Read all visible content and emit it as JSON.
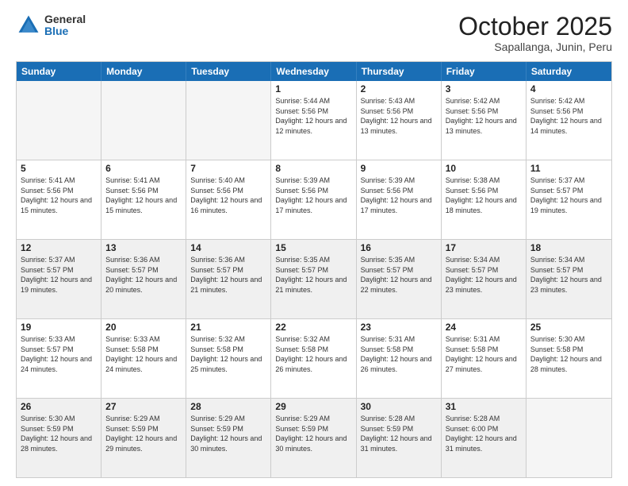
{
  "logo": {
    "general": "General",
    "blue": "Blue"
  },
  "title": "October 2025",
  "location": "Sapallanga, Junin, Peru",
  "days_of_week": [
    "Sunday",
    "Monday",
    "Tuesday",
    "Wednesday",
    "Thursday",
    "Friday",
    "Saturday"
  ],
  "weeks": [
    [
      {
        "day": "",
        "info": "",
        "empty": true
      },
      {
        "day": "",
        "info": "",
        "empty": true
      },
      {
        "day": "",
        "info": "",
        "empty": true
      },
      {
        "day": "1",
        "info": "Sunrise: 5:44 AM\nSunset: 5:56 PM\nDaylight: 12 hours\nand 12 minutes."
      },
      {
        "day": "2",
        "info": "Sunrise: 5:43 AM\nSunset: 5:56 PM\nDaylight: 12 hours\nand 13 minutes."
      },
      {
        "day": "3",
        "info": "Sunrise: 5:42 AM\nSunset: 5:56 PM\nDaylight: 12 hours\nand 13 minutes."
      },
      {
        "day": "4",
        "info": "Sunrise: 5:42 AM\nSunset: 5:56 PM\nDaylight: 12 hours\nand 14 minutes."
      }
    ],
    [
      {
        "day": "5",
        "info": "Sunrise: 5:41 AM\nSunset: 5:56 PM\nDaylight: 12 hours\nand 15 minutes."
      },
      {
        "day": "6",
        "info": "Sunrise: 5:41 AM\nSunset: 5:56 PM\nDaylight: 12 hours\nand 15 minutes."
      },
      {
        "day": "7",
        "info": "Sunrise: 5:40 AM\nSunset: 5:56 PM\nDaylight: 12 hours\nand 16 minutes."
      },
      {
        "day": "8",
        "info": "Sunrise: 5:39 AM\nSunset: 5:56 PM\nDaylight: 12 hours\nand 17 minutes."
      },
      {
        "day": "9",
        "info": "Sunrise: 5:39 AM\nSunset: 5:56 PM\nDaylight: 12 hours\nand 17 minutes."
      },
      {
        "day": "10",
        "info": "Sunrise: 5:38 AM\nSunset: 5:56 PM\nDaylight: 12 hours\nand 18 minutes."
      },
      {
        "day": "11",
        "info": "Sunrise: 5:37 AM\nSunset: 5:57 PM\nDaylight: 12 hours\nand 19 minutes."
      }
    ],
    [
      {
        "day": "12",
        "info": "Sunrise: 5:37 AM\nSunset: 5:57 PM\nDaylight: 12 hours\nand 19 minutes.",
        "shaded": true
      },
      {
        "day": "13",
        "info": "Sunrise: 5:36 AM\nSunset: 5:57 PM\nDaylight: 12 hours\nand 20 minutes.",
        "shaded": true
      },
      {
        "day": "14",
        "info": "Sunrise: 5:36 AM\nSunset: 5:57 PM\nDaylight: 12 hours\nand 21 minutes.",
        "shaded": true
      },
      {
        "day": "15",
        "info": "Sunrise: 5:35 AM\nSunset: 5:57 PM\nDaylight: 12 hours\nand 21 minutes.",
        "shaded": true
      },
      {
        "day": "16",
        "info": "Sunrise: 5:35 AM\nSunset: 5:57 PM\nDaylight: 12 hours\nand 22 minutes.",
        "shaded": true
      },
      {
        "day": "17",
        "info": "Sunrise: 5:34 AM\nSunset: 5:57 PM\nDaylight: 12 hours\nand 23 minutes.",
        "shaded": true
      },
      {
        "day": "18",
        "info": "Sunrise: 5:34 AM\nSunset: 5:57 PM\nDaylight: 12 hours\nand 23 minutes.",
        "shaded": true
      }
    ],
    [
      {
        "day": "19",
        "info": "Sunrise: 5:33 AM\nSunset: 5:57 PM\nDaylight: 12 hours\nand 24 minutes."
      },
      {
        "day": "20",
        "info": "Sunrise: 5:33 AM\nSunset: 5:58 PM\nDaylight: 12 hours\nand 24 minutes."
      },
      {
        "day": "21",
        "info": "Sunrise: 5:32 AM\nSunset: 5:58 PM\nDaylight: 12 hours\nand 25 minutes."
      },
      {
        "day": "22",
        "info": "Sunrise: 5:32 AM\nSunset: 5:58 PM\nDaylight: 12 hours\nand 26 minutes."
      },
      {
        "day": "23",
        "info": "Sunrise: 5:31 AM\nSunset: 5:58 PM\nDaylight: 12 hours\nand 26 minutes."
      },
      {
        "day": "24",
        "info": "Sunrise: 5:31 AM\nSunset: 5:58 PM\nDaylight: 12 hours\nand 27 minutes."
      },
      {
        "day": "25",
        "info": "Sunrise: 5:30 AM\nSunset: 5:58 PM\nDaylight: 12 hours\nand 28 minutes."
      }
    ],
    [
      {
        "day": "26",
        "info": "Sunrise: 5:30 AM\nSunset: 5:59 PM\nDaylight: 12 hours\nand 28 minutes.",
        "shaded": true
      },
      {
        "day": "27",
        "info": "Sunrise: 5:29 AM\nSunset: 5:59 PM\nDaylight: 12 hours\nand 29 minutes.",
        "shaded": true
      },
      {
        "day": "28",
        "info": "Sunrise: 5:29 AM\nSunset: 5:59 PM\nDaylight: 12 hours\nand 30 minutes.",
        "shaded": true
      },
      {
        "day": "29",
        "info": "Sunrise: 5:29 AM\nSunset: 5:59 PM\nDaylight: 12 hours\nand 30 minutes.",
        "shaded": true
      },
      {
        "day": "30",
        "info": "Sunrise: 5:28 AM\nSunset: 5:59 PM\nDaylight: 12 hours\nand 31 minutes.",
        "shaded": true
      },
      {
        "day": "31",
        "info": "Sunrise: 5:28 AM\nSunset: 6:00 PM\nDaylight: 12 hours\nand 31 minutes.",
        "shaded": true
      },
      {
        "day": "",
        "info": "",
        "empty": true,
        "shaded": true
      }
    ]
  ]
}
